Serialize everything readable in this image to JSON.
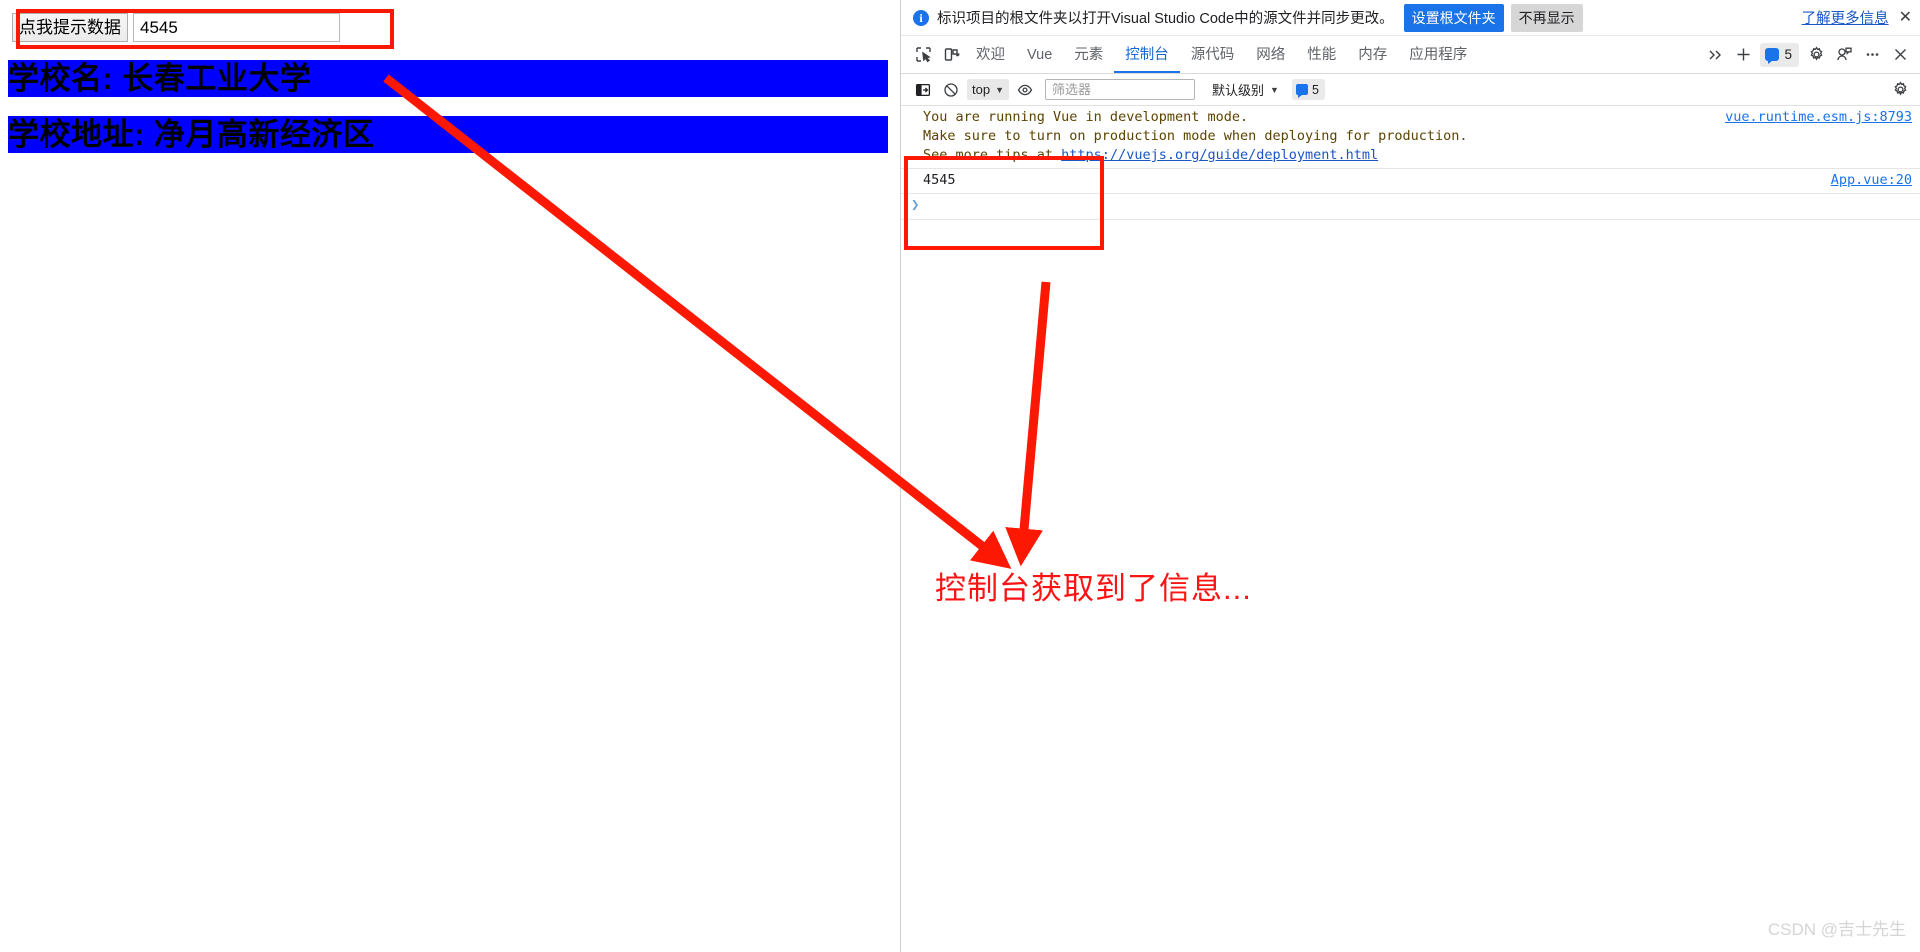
{
  "page": {
    "button_label": "点我提示数据",
    "input_value": "4545",
    "input_placeholder": "",
    "school_name_line": "学校名: 长春工业大学",
    "school_address_line": "学校地址: 净月高新经济区"
  },
  "devtools": {
    "notification": {
      "icon": "info-icon",
      "message": "标识项目的根文件夹以打开Visual Studio Code中的源文件并同步更改。",
      "primary_button": "设置根文件夹",
      "secondary_button": "不再显示",
      "learn_more": "了解更多信息",
      "close": "✕"
    },
    "tabs": {
      "inspect_icon": "inspect-element-icon",
      "device_icon": "device-toolbar-icon",
      "items": [
        {
          "label": "欢迎",
          "active": false
        },
        {
          "label": "Vue",
          "active": false
        },
        {
          "label": "元素",
          "active": false
        },
        {
          "label": "控制台",
          "active": true
        },
        {
          "label": "源代码",
          "active": false
        },
        {
          "label": "网络",
          "active": false
        },
        {
          "label": "性能",
          "active": false
        },
        {
          "label": "内存",
          "active": false
        },
        {
          "label": "应用程序",
          "active": false
        }
      ],
      "more_tabs_icon": "chevron-double-right-icon",
      "add_tab_icon": "plus-icon",
      "message_count": "5",
      "settings_icon": "gear-icon",
      "feedback_icon": "feedback-icon",
      "more_options_icon": "ellipsis-icon",
      "close_icon": "close-icon"
    },
    "console_toolbar": {
      "sidebar_icon": "console-sidebar-icon",
      "clear_icon": "clear-console-icon",
      "context": "top",
      "context_caret": "▼",
      "eye_icon": "live-expression-icon",
      "filter_placeholder": "筛选器",
      "filter_value": "",
      "level": "默认级别",
      "level_caret": "▼",
      "level_count": "5",
      "settings_icon": "gear-icon"
    },
    "console_entries": [
      {
        "kind": "warning",
        "lines": [
          "You are running Vue in development mode.",
          "Make sure to turn on production mode when deploying for production.",
          "See more tips at "
        ],
        "inline_link": "https://vuejs.org/guide/deployment.html",
        "source": "vue.runtime.esm.js:8793"
      },
      {
        "kind": "log",
        "lines": [
          "4545"
        ],
        "inline_link": "",
        "source": "App.vue:20"
      }
    ],
    "console_prompt": "❯"
  },
  "annotations": {
    "text": "控制台获取到了信息...",
    "accent_color": "#fc1803",
    "text_color": "#fc1414"
  },
  "watermark": "CSDN @吉士先生"
}
